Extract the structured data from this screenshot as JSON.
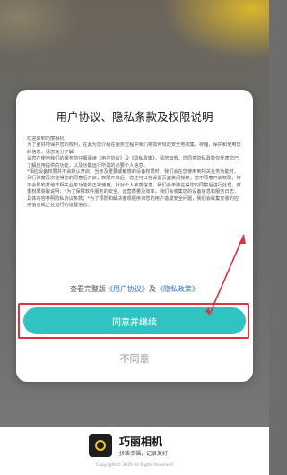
{
  "dialog": {
    "title": "用户协议、隐私条款及权限说明",
    "paragraphs": [
      "欢迎来到巧丽相机！",
      "为了更好地保护您的权利，在此为您介绍在服务过程中我们将如何规范安全地收集、存储、保护和使用您的信息，请您充分了解：",
      "请您在使用我们的服务前仔细阅读《用户协议》及《隐私政策》，请您知悉，您同意隐私政策仅代表您已了解应用提供的功能，以及功能运行所需的必要个人信息。",
      "*相应设备权限并不会默认开启，当涉及重要或敏感的设备权限时，我们会在您使用到相关业务功能时，另行弹窗再次征得您的同意后开启；权限开启后，您还可以在设置页面关闭授权；您不同意开启权限，将不会影响其他非相关业务功能的正常使用。针对个人敏感信息，我们会单独征得您的同意后进行处理，慎重权限获取说明：*为了保障软件服务的安全、运营质量及效率，我们会收集您的设备信息和服务日志，具体内容参照隐私协议条款；*为了预防和解决客观程序对您的用户造成安全问题，我们会收集安装的应用信息或正在运行的进程信息。"
    ],
    "footer_prefix": "查看完整版",
    "footer_link1": "《用户协议》",
    "footer_mid": "及",
    "footer_link2": "《隐私政策》",
    "agree_label": "同意并继续",
    "disagree_label": "不同意"
  },
  "app": {
    "name": "巧丽相机",
    "slogan": "拼凑幸福，记录美好",
    "copyright": "Copyright © 2020 All Rights Reserved"
  },
  "colors": {
    "accent": "#2fc4c1",
    "link": "#2f6fd8",
    "highlight": "#e0323c"
  }
}
